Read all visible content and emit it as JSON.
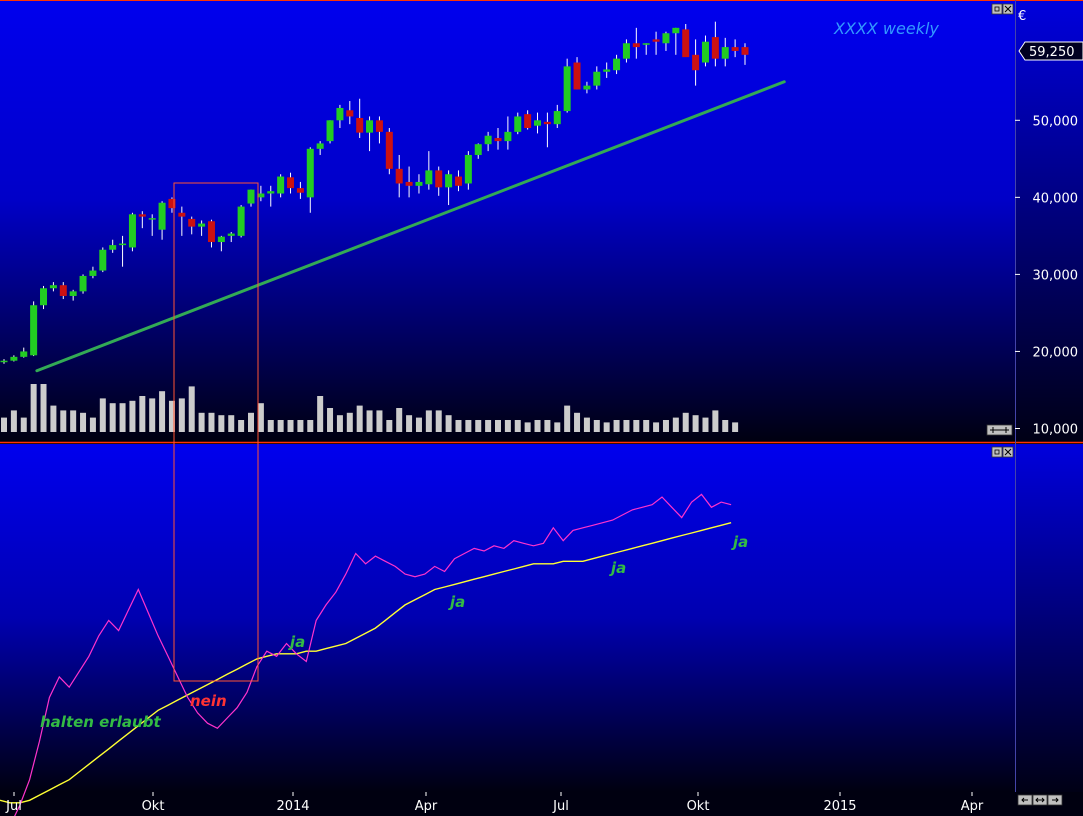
{
  "title": "XXXX weekly",
  "currency_symbol": "€",
  "last_price_label": "59,250",
  "colors": {
    "bg_top": "#0000ee",
    "bg_bottom": "#000010",
    "up_candle": "#22cc22",
    "down_candle": "#cc1111",
    "wick": "#ffffff",
    "volume": "#cccccc",
    "trendline": "#33aa55",
    "indicator_line": "#ff33cc",
    "signal_line": "#ffff33",
    "highlight_box": "#ff5533",
    "ann_green": "#33bb44",
    "ann_red": "#ff3333",
    "title_color": "#3399ff",
    "axis_text": "#ffffff",
    "panel_border": "#ff3300"
  },
  "x_axis_labels": [
    "Jul",
    "Okt",
    "2014",
    "Apr",
    "Jul",
    "Okt",
    "2015",
    "Apr"
  ],
  "annotations": [
    {
      "text": "halten erlaubt",
      "color": "green"
    },
    {
      "text": "nein",
      "color": "red"
    },
    {
      "text": "ja",
      "color": "green"
    },
    {
      "text": "ja",
      "color": "green"
    },
    {
      "text": "ja",
      "color": "green"
    },
    {
      "text": "ja",
      "color": "green"
    }
  ],
  "chart_data": [
    {
      "type": "candlestick",
      "title": "XXXX weekly",
      "x": "weeks, Jul 2013 – Nov 2014",
      "y_ticks": [
        "10,000",
        "20,000",
        "30,000",
        "40,000",
        "50,000"
      ],
      "ylim": [
        10000,
        62000
      ],
      "grid": false,
      "candles": [
        [
          18700,
          19000,
          18400,
          18800
        ],
        [
          18800,
          19500,
          18700,
          19300
        ],
        [
          19300,
          20500,
          19200,
          20000
        ],
        [
          19500,
          26500,
          19400,
          26000
        ],
        [
          26000,
          28500,
          25500,
          28200
        ],
        [
          28200,
          29000,
          27800,
          28600
        ],
        [
          28600,
          29000,
          26800,
          27200
        ],
        [
          27200,
          28000,
          26600,
          27800
        ],
        [
          27800,
          30000,
          27500,
          29800
        ],
        [
          29800,
          31000,
          29500,
          30500
        ],
        [
          30500,
          33500,
          30300,
          33200
        ],
        [
          33200,
          34500,
          32800,
          33800
        ],
        [
          33800,
          35000,
          31000,
          34000
        ],
        [
          33500,
          38000,
          33000,
          37800
        ],
        [
          37800,
          38200,
          36000,
          37500
        ],
        [
          37200,
          37800,
          35000,
          37300
        ],
        [
          35800,
          39500,
          34500,
          39300
        ],
        [
          39800,
          40000,
          38000,
          38600
        ],
        [
          38000,
          38800,
          35000,
          37500
        ],
        [
          37200,
          37500,
          35200,
          36200
        ],
        [
          36200,
          37000,
          35000,
          36600
        ],
        [
          36900,
          37100,
          33500,
          34200
        ],
        [
          34200,
          35000,
          33000,
          34900
        ],
        [
          35000,
          35500,
          34200,
          35300
        ],
        [
          35000,
          39000,
          34800,
          38800
        ],
        [
          39200,
          41000,
          38800,
          41000
        ],
        [
          40000,
          41500,
          39500,
          40500
        ],
        [
          40500,
          41500,
          38800,
          40800
        ],
        [
          40500,
          43000,
          40000,
          42700
        ],
        [
          42600,
          43200,
          40500,
          41200
        ],
        [
          41200,
          42000,
          39800,
          40600
        ],
        [
          40000,
          46500,
          38000,
          46300
        ],
        [
          46300,
          47300,
          45500,
          47000
        ],
        [
          47300,
          50000,
          47000,
          50000
        ],
        [
          50000,
          52000,
          49000,
          51600
        ],
        [
          51300,
          52500,
          49500,
          50500
        ],
        [
          50300,
          52800,
          47700,
          48400
        ],
        [
          48400,
          50500,
          46000,
          50000
        ],
        [
          50000,
          50500,
          47000,
          48500
        ],
        [
          48500,
          49000,
          43000,
          43700
        ],
        [
          43700,
          45500,
          40000,
          41800
        ],
        [
          42000,
          44000,
          40000,
          41500
        ],
        [
          41500,
          43000,
          40500,
          42000
        ],
        [
          41700,
          46000,
          41000,
          43500
        ],
        [
          43500,
          44000,
          40200,
          41300
        ],
        [
          41300,
          43500,
          39000,
          43000
        ],
        [
          42700,
          43500,
          40800,
          41500
        ],
        [
          41800,
          46000,
          41000,
          45500
        ],
        [
          45500,
          47000,
          45000,
          46900
        ],
        [
          46900,
          48500,
          46000,
          48000
        ],
        [
          47700,
          49000,
          46200,
          47300
        ],
        [
          47300,
          50500,
          46200,
          48500
        ],
        [
          48500,
          51000,
          48200,
          50500
        ],
        [
          50800,
          51300,
          48800,
          49000
        ],
        [
          49300,
          51000,
          48300,
          50000
        ],
        [
          49800,
          51000,
          46500,
          49500
        ],
        [
          49500,
          52000,
          49000,
          51200
        ],
        [
          51200,
          58000,
          51000,
          57000
        ],
        [
          57500,
          58200,
          54000,
          54000
        ],
        [
          54000,
          55000,
          53500,
          54500
        ],
        [
          54500,
          57000,
          54000,
          56300
        ],
        [
          56300,
          57500,
          55500,
          56600
        ],
        [
          56500,
          58500,
          56000,
          58000
        ],
        [
          58000,
          60500,
          57500,
          60000
        ],
        [
          60000,
          62000,
          58000,
          59500
        ],
        [
          59800,
          60000,
          58500,
          60000
        ],
        [
          60500,
          61500,
          58500,
          60200
        ],
        [
          60000,
          61500,
          59000,
          61300
        ],
        [
          61300,
          62000,
          58500,
          62000
        ],
        [
          61800,
          62500,
          58500,
          58200
        ],
        [
          58500,
          60500,
          54500,
          56500
        ],
        [
          57500,
          61000,
          57000,
          60200
        ],
        [
          60800,
          62800,
          57000,
          58000
        ],
        [
          58000,
          60700,
          57000,
          59500
        ],
        [
          59500,
          60500,
          58200,
          59000
        ],
        [
          59500,
          60000,
          57200,
          58500
        ]
      ],
      "volume_relative": [
        0.3,
        0.45,
        0.3,
        1.0,
        1.0,
        0.55,
        0.45,
        0.45,
        0.4,
        0.3,
        0.7,
        0.6,
        0.6,
        0.65,
        0.75,
        0.7,
        0.85,
        0.65,
        0.7,
        0.95,
        0.4,
        0.4,
        0.35,
        0.35,
        0.25,
        0.4,
        0.6,
        0.25,
        0.25,
        0.25,
        0.25,
        0.25,
        0.75,
        0.5,
        0.35,
        0.4,
        0.55,
        0.45,
        0.45,
        0.25,
        0.5,
        0.35,
        0.3,
        0.45,
        0.45,
        0.35,
        0.25,
        0.25,
        0.25,
        0.25,
        0.25,
        0.25,
        0.25,
        0.2,
        0.25,
        0.25,
        0.2,
        0.55,
        0.4,
        0.3,
        0.25,
        0.2,
        0.25,
        0.25,
        0.25,
        0.25,
        0.2,
        0.25,
        0.3,
        0.4,
        0.35,
        0.3,
        0.45,
        0.25,
        0.2
      ],
      "trendline_start_end": [
        [
          1,
          17500
        ],
        [
          73,
          55000
        ]
      ]
    },
    {
      "type": "line",
      "series": [
        {
          "values": [
            -0.35,
            -0.28,
            -0.2,
            -0.1,
            0.05,
            0.22,
            0.3,
            0.26,
            0.32,
            0.38,
            0.46,
            0.52,
            0.48,
            0.56,
            0.64,
            0.55,
            0.46,
            0.38,
            0.3,
            0.22,
            0.16,
            0.12,
            0.1,
            0.14,
            0.18,
            0.24,
            0.34,
            0.4,
            0.38,
            0.43,
            0.39,
            0.36,
            0.52,
            0.58,
            0.63,
            0.7,
            0.78,
            0.74,
            0.77,
            0.75,
            0.73,
            0.7,
            0.69,
            0.7,
            0.73,
            0.71,
            0.76,
            0.78,
            0.8,
            0.79,
            0.81,
            0.8,
            0.83,
            0.82,
            0.81,
            0.82,
            0.88,
            0.83,
            0.87,
            0.88,
            0.89,
            0.9,
            0.91,
            0.93,
            0.95,
            0.96,
            0.97,
            1.0,
            0.96,
            0.92,
            0.98,
            1.01,
            0.96,
            0.98,
            0.97
          ]
        },
        {
          "values": [
            -0.18,
            -0.19,
            -0.19,
            -0.18,
            -0.16,
            -0.14,
            -0.12,
            -0.1,
            -0.07,
            -0.04,
            -0.01,
            0.02,
            0.05,
            0.08,
            0.11,
            0.14,
            0.17,
            0.19,
            0.21,
            0.23,
            0.25,
            0.27,
            0.29,
            0.31,
            0.33,
            0.35,
            0.37,
            0.38,
            0.39,
            0.39,
            0.39,
            0.4,
            0.4,
            0.41,
            0.42,
            0.43,
            0.45,
            0.47,
            0.49,
            0.52,
            0.55,
            0.58,
            0.6,
            0.62,
            0.64,
            0.65,
            0.66,
            0.67,
            0.68,
            0.69,
            0.7,
            0.71,
            0.72,
            0.73,
            0.74,
            0.74,
            0.74,
            0.75,
            0.75,
            0.75,
            0.76,
            0.77,
            0.78,
            0.79,
            0.8,
            0.81,
            0.82,
            0.83,
            0.84,
            0.85,
            0.86,
            0.87,
            0.88,
            0.89,
            0.9
          ]
        }
      ]
    }
  ]
}
